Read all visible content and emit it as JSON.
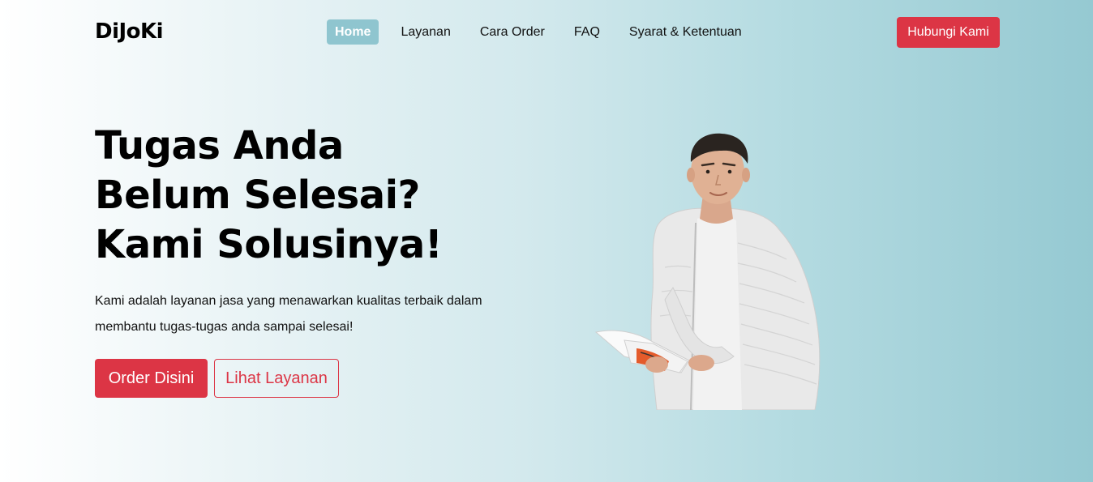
{
  "navbar": {
    "brand": "DiJoKi",
    "items": [
      {
        "label": "Home",
        "active": true
      },
      {
        "label": "Layanan"
      },
      {
        "label": "Cara Order"
      },
      {
        "label": "FAQ"
      },
      {
        "label": "Syarat & Ketentuan"
      }
    ],
    "contact_label": "Hubungi Kami"
  },
  "hero": {
    "title_line1": "Tugas Anda",
    "title_line2": "Belum Selesai?",
    "title_line3": "Kami Solusinya!",
    "description": "Kami adalah layanan jasa yang menawarkan kualitas terbaik dalam membantu tugas-tugas anda sampai selesai!",
    "primary_button": "Order Disini",
    "secondary_button": "Lihat Layanan"
  },
  "colors": {
    "accent": "#dc3545",
    "nav_active": "#8fc5cf",
    "background_end": "#95c9d2"
  },
  "images": {
    "hero_image": "person-holding-book"
  }
}
